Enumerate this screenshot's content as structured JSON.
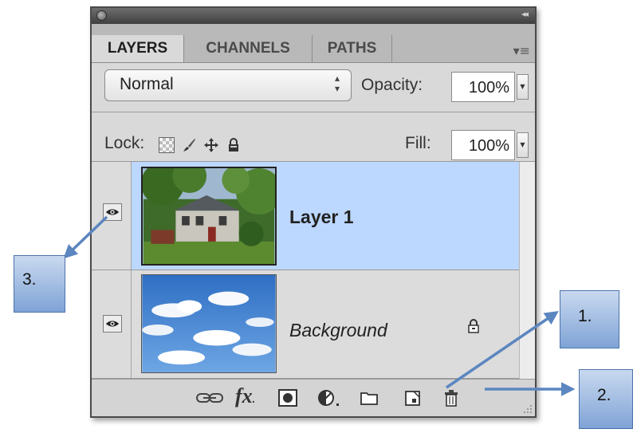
{
  "panel": {
    "tabs": [
      {
        "label": "LAYERS",
        "active": true
      },
      {
        "label": "CHANNELS",
        "active": false
      },
      {
        "label": "PATHS",
        "active": false
      }
    ],
    "blend_mode": "Normal",
    "opacity_label": "Opacity:",
    "opacity_value": "100%",
    "lock_label": "Lock:",
    "fill_label": "Fill:",
    "fill_value": "100%"
  },
  "layers": [
    {
      "name": "Layer 1",
      "selected": true,
      "visible": true,
      "italic": false
    },
    {
      "name": "Background",
      "selected": false,
      "visible": true,
      "italic": true,
      "locked": true
    }
  ],
  "bottom_toolbar": [
    "link-layers-icon",
    "fx-icon",
    "add-mask-icon",
    "adjustment-layer-icon",
    "new-group-icon",
    "new-layer-icon",
    "delete-layer-icon"
  ],
  "callouts": {
    "c1": "1.",
    "c2": "2.",
    "c3": "3."
  },
  "colors": {
    "selected_row": "#bcd8ff",
    "callout_fill": "#7fa3d6",
    "arrow": "#5b86c0"
  }
}
